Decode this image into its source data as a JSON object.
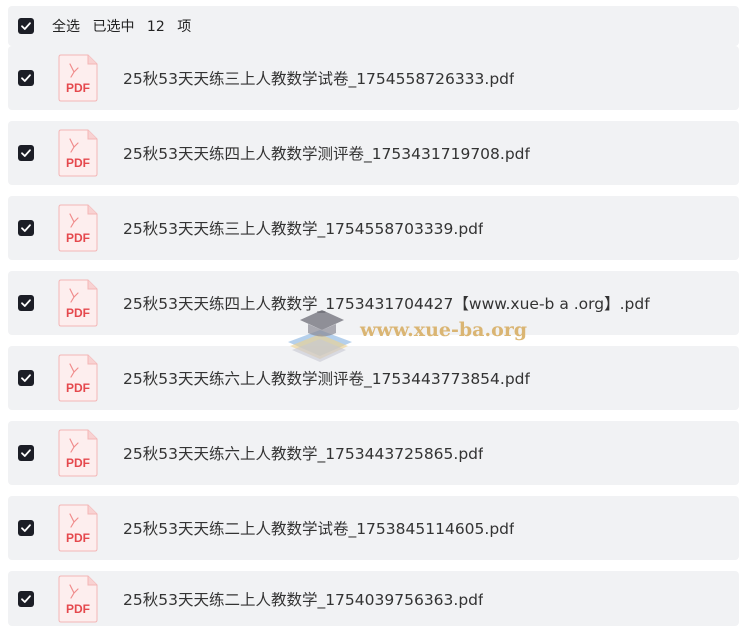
{
  "header": {
    "select_all_label": "全选",
    "selected_prefix": "已选中",
    "selected_count": "12",
    "selected_suffix": "项"
  },
  "file_icon_label": "PDF",
  "files": [
    {
      "name": "25秋53天天练三上人教数学试卷_1754558726333.pdf",
      "checked": true
    },
    {
      "name": "25秋53天天练四上人教数学测评卷_1753431719708.pdf",
      "checked": true
    },
    {
      "name": "25秋53天天练三上人教数学_1754558703339.pdf",
      "checked": true
    },
    {
      "name": "25秋53天天练四上人教数学_1753431704427【www.xue-b a .org】.pdf",
      "checked": true
    },
    {
      "name": "25秋53天天练六上人教数学测评卷_1753443773854.pdf",
      "checked": true
    },
    {
      "name": "25秋53天天练六上人教数学_1753443725865.pdf",
      "checked": true
    },
    {
      "name": "25秋53天天练二上人教数学试卷_1753845114605.pdf",
      "checked": true
    },
    {
      "name": "25秋53天天练二上人教数学_1754039756363.pdf",
      "checked": true
    }
  ],
  "watermark": {
    "text": "www.xue-ba.org",
    "icon": "graduation-cap-books-icon"
  },
  "colors": {
    "row_bg": "#f1f2f4",
    "checkbox": "#1c1e26",
    "pdf_red": "#e5484d",
    "watermark": "#d6aa5c"
  }
}
